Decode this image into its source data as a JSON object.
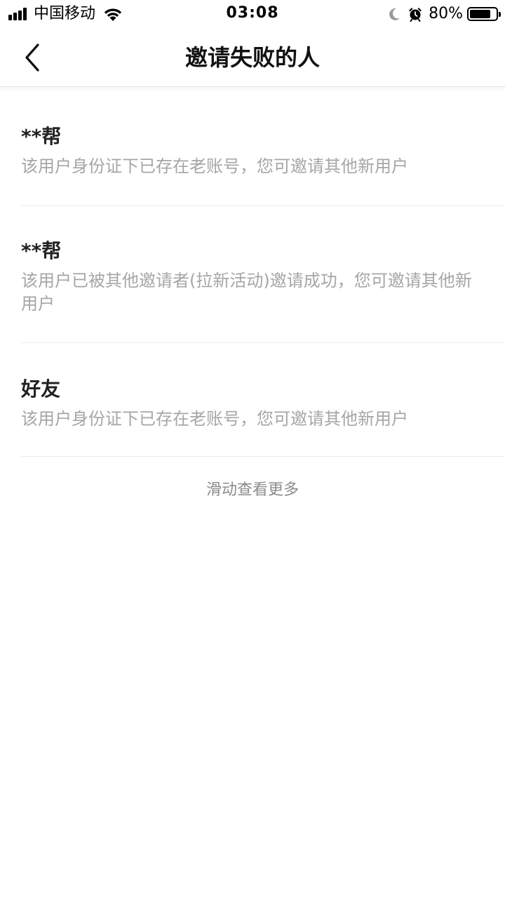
{
  "status_bar": {
    "carrier": "中国移动",
    "time": "03:08",
    "battery_percent": "80%",
    "battery_level": 0.8,
    "signal_bars": 4,
    "icons": [
      "signal-icon",
      "wifi-icon",
      "moon-icon",
      "alarm-icon",
      "battery-icon"
    ]
  },
  "header": {
    "title": "邀请失败的人",
    "back_icon": "chevron-left-icon"
  },
  "items": [
    {
      "name": "**帮",
      "desc": "该用户身份证下已存在老账号，您可邀请其他新用户"
    },
    {
      "name": "**帮",
      "desc": "该用户已被其他邀请者(拉新活动)邀请成功，您可邀请其他新用户"
    },
    {
      "name": "好友",
      "desc": "该用户身份证下已存在老账号，您可邀请其他新用户"
    }
  ],
  "footer": {
    "scroll_more": "滑动查看更多"
  },
  "colors": {
    "title_text": "#111111",
    "name_text": "#222222",
    "desc_text": "#a6a6a6",
    "hint_text": "#8c8c8c",
    "divider": "#ebebeb",
    "background": "#ffffff"
  }
}
